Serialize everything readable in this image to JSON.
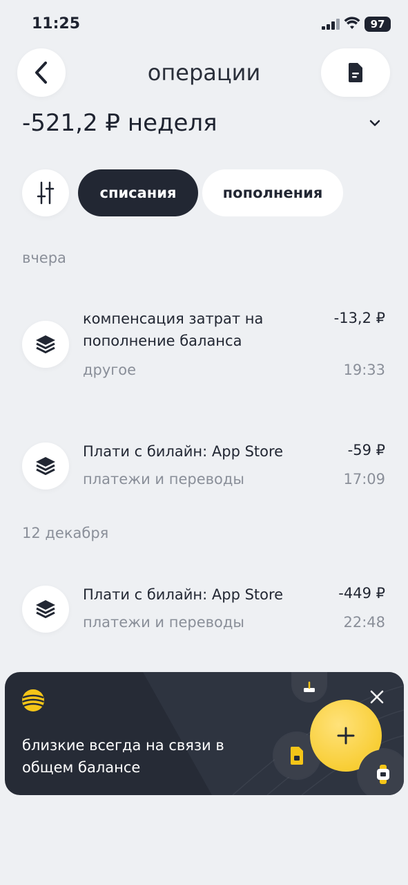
{
  "status_bar": {
    "time": "11:25",
    "battery": "97"
  },
  "header": {
    "title": "операции"
  },
  "summary": {
    "amount": "-521,2 ₽ неделя"
  },
  "filters": {
    "active": "списания",
    "inactive": "пополнения"
  },
  "sections": [
    {
      "label": "вчера",
      "items": [
        {
          "title": "компенсация затрат на пополнение баланса",
          "category": "другое",
          "amount": "-13,2 ₽",
          "time": "19:33"
        },
        {
          "title": "Плати с билайн: App Store",
          "category": "платежи и переводы",
          "amount": "-59 ₽",
          "time": "17:09"
        }
      ]
    },
    {
      "label": "12 декабря",
      "items": [
        {
          "title": "Плати с билайн: App Store",
          "category": "платежи и переводы",
          "amount": "-449 ₽",
          "time": "22:48"
        }
      ]
    }
  ],
  "banner": {
    "text": "близкие всегда на связи в общем балансе"
  },
  "icons": {
    "back": "chevron-left-icon",
    "document": "document-icon",
    "dropdown": "chevron-down-icon",
    "filter": "sliders-icon",
    "transaction": "layers-icon",
    "close": "close-icon",
    "plus": "plus-icon"
  },
  "colors": {
    "accent": "#f5c518",
    "dark": "#222733",
    "background": "#eef0f3"
  }
}
